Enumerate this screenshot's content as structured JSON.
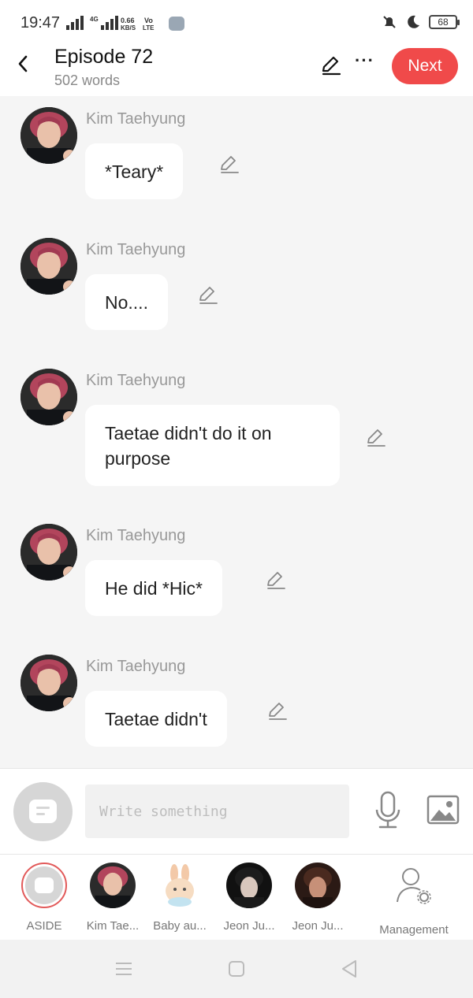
{
  "status_bar": {
    "time": "19:47",
    "net_type": "4G",
    "speed_value": "0.66",
    "speed_unit": "KB/S",
    "volte_top": "Vo",
    "volte_bottom": "LTE",
    "battery": "68",
    "icons": [
      "signal-icon",
      "signal-icon",
      "app-notification-icon",
      "mute-icon",
      "moon-icon",
      "battery-icon"
    ]
  },
  "header": {
    "title": "Episode 72",
    "subtitle": "502 words",
    "next_label": "Next",
    "icons": [
      "back-arrow-icon",
      "pencil-icon",
      "more-icon"
    ]
  },
  "messages": [
    {
      "sender": "Kim Taehyung",
      "text": "*Teary*"
    },
    {
      "sender": "Kim Taehyung",
      "text": "No...."
    },
    {
      "sender": "Kim Taehyung",
      "text": "Taetae didn't do it on purpose"
    },
    {
      "sender": "Kim Taehyung",
      "text": "He did *Hic*"
    },
    {
      "sender": "Kim Taehyung",
      "text": "Taetae didn't"
    }
  ],
  "composer": {
    "placeholder": "Write something",
    "icons": [
      "aside-toggle-icon",
      "microphone-icon",
      "image-icon"
    ]
  },
  "characters": [
    {
      "name": "ASIDE",
      "selected": true
    },
    {
      "name": "Kim Tae..."
    },
    {
      "name": "Baby au..."
    },
    {
      "name": "Jeon Ju..."
    },
    {
      "name": "Jeon Ju..."
    },
    {
      "name": "Management"
    }
  ],
  "nav": {
    "icons": [
      "menu-icon",
      "home-icon",
      "back-triangle-icon"
    ]
  },
  "colors": {
    "accent": "#f04a4a",
    "background": "#f5f5f5",
    "bubble": "#ffffff",
    "muted_text": "#999999"
  }
}
